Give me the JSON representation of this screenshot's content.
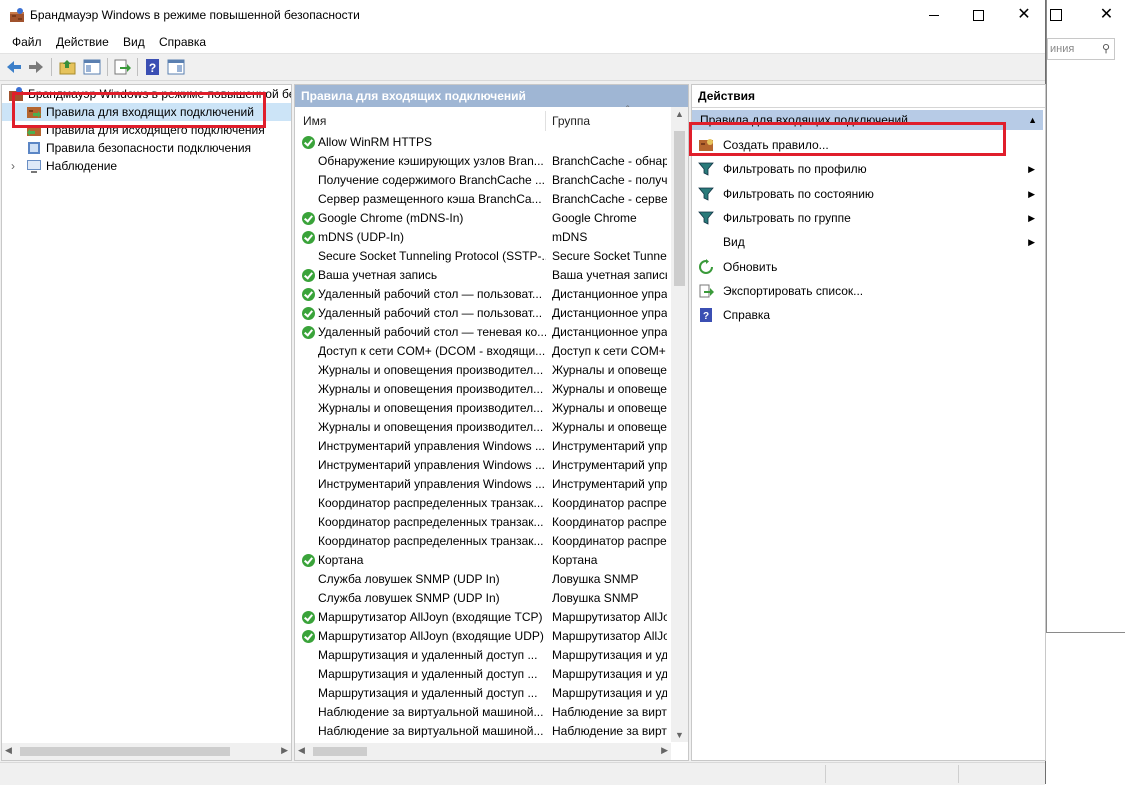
{
  "background_window": {
    "search_placeholder": "иния",
    "close_glyph": "✕"
  },
  "window": {
    "title": "Брандмауэр Windows в режиме повышенной безопасности",
    "min_glyph": "",
    "close_glyph": "✕"
  },
  "menu": [
    "Файл",
    "Действие",
    "Вид",
    "Справка"
  ],
  "tree": {
    "root": "Брандмауэр Windows в режиме повышенной безопасности на Локальный компьютер",
    "items": [
      "Правила для входящих подключений",
      "Правила для исходящего подключения",
      "Правила безопасности подключения",
      "Наблюдение"
    ]
  },
  "rules_pane": {
    "header": "Правила для входящих подключений",
    "col_name": "Имя",
    "col_group": "Группа",
    "rows": [
      {
        "enabled": true,
        "name": "Allow WinRM HTTPS",
        "group": ""
      },
      {
        "enabled": false,
        "name": "Обнаружение кэширующих узлов Bran...",
        "group": "BranchCache - обнар"
      },
      {
        "enabled": false,
        "name": "Получение содержимого BranchCache ...",
        "group": "BranchCache - получ"
      },
      {
        "enabled": false,
        "name": "Сервер размещенного кэша BranchCa...",
        "group": "BranchCache - сервер"
      },
      {
        "enabled": true,
        "name": "Google Chrome (mDNS-In)",
        "group": "Google Chrome"
      },
      {
        "enabled": true,
        "name": "mDNS (UDP-In)",
        "group": "mDNS"
      },
      {
        "enabled": false,
        "name": "Secure Socket Tunneling Protocol (SSTP-...",
        "group": "Secure Socket Tunneli"
      },
      {
        "enabled": true,
        "name": "Ваша учетная запись",
        "group": "Ваша учетная запись"
      },
      {
        "enabled": true,
        "name": "Удаленный рабочий стол — пользоват...",
        "group": "Дистанционное упра"
      },
      {
        "enabled": true,
        "name": "Удаленный рабочий стол — пользоват...",
        "group": "Дистанционное упра"
      },
      {
        "enabled": true,
        "name": "Удаленный рабочий стол — теневая ко...",
        "group": "Дистанционное упра"
      },
      {
        "enabled": false,
        "name": "Доступ к сети COM+ (DCOM - входящи...",
        "group": "Доступ к сети COM+"
      },
      {
        "enabled": false,
        "name": "Журналы и оповещения производител...",
        "group": "Журналы и оповеще"
      },
      {
        "enabled": false,
        "name": "Журналы и оповещения производител...",
        "group": "Журналы и оповеще"
      },
      {
        "enabled": false,
        "name": "Журналы и оповещения производител...",
        "group": "Журналы и оповеще"
      },
      {
        "enabled": false,
        "name": "Журналы и оповещения производител...",
        "group": "Журналы и оповеще"
      },
      {
        "enabled": false,
        "name": "Инструментарий управления Windows ...",
        "group": "Инструментарий упр"
      },
      {
        "enabled": false,
        "name": "Инструментарий управления Windows ...",
        "group": "Инструментарий упр"
      },
      {
        "enabled": false,
        "name": "Инструментарий управления Windows ...",
        "group": "Инструментарий упр"
      },
      {
        "enabled": false,
        "name": "Координатор распределенных транзак...",
        "group": "Координатор распре"
      },
      {
        "enabled": false,
        "name": "Координатор распределенных транзак...",
        "group": "Координатор распре"
      },
      {
        "enabled": false,
        "name": "Координатор распределенных транзак...",
        "group": "Координатор распре"
      },
      {
        "enabled": true,
        "name": "Кортана",
        "group": "Кортана"
      },
      {
        "enabled": false,
        "name": "Служба ловушек SNMP (UDP In)",
        "group": "Ловушка SNMP"
      },
      {
        "enabled": false,
        "name": "Служба ловушек SNMP (UDP In)",
        "group": "Ловушка SNMP"
      },
      {
        "enabled": true,
        "name": "Маршрутизатор AllJoyn (входящие TCP)",
        "group": "Маршрутизатор AllJo"
      },
      {
        "enabled": true,
        "name": "Маршрутизатор AllJoyn (входящие UDP)",
        "group": "Маршрутизатор AllJo"
      },
      {
        "enabled": false,
        "name": "Маршрутизация и удаленный доступ ...",
        "group": "Маршрутизация и уд"
      },
      {
        "enabled": false,
        "name": "Маршрутизация и удаленный доступ ...",
        "group": "Маршрутизация и уд"
      },
      {
        "enabled": false,
        "name": "Маршрутизация и удаленный доступ ...",
        "group": "Маршрутизация и уд"
      },
      {
        "enabled": false,
        "name": "Наблюдение за виртуальной машиной...",
        "group": "Наблюдение за вирту"
      },
      {
        "enabled": false,
        "name": "Наблюдение за виртуальной машиной...",
        "group": "Наблюдение за вирту"
      }
    ]
  },
  "actions_pane": {
    "header": "Действия",
    "subheader": "Правила для входящих подключений",
    "items": [
      {
        "label": "Создать правило...",
        "icon": "new-rule-icon",
        "submenu": false
      },
      {
        "label": "Фильтровать по профилю",
        "icon": "filter-icon",
        "submenu": true
      },
      {
        "label": "Фильтровать по состоянию",
        "icon": "filter-icon",
        "submenu": true
      },
      {
        "label": "Фильтровать по группе",
        "icon": "filter-icon",
        "submenu": true
      },
      {
        "label": "Вид",
        "icon": "",
        "submenu": true
      },
      {
        "label": "Обновить",
        "icon": "refresh-icon",
        "submenu": false
      },
      {
        "label": "Экспортировать список...",
        "icon": "export-icon",
        "submenu": false
      },
      {
        "label": "Справка",
        "icon": "help-icon",
        "submenu": false
      }
    ]
  },
  "colors": {
    "highlight": "#e01e2b",
    "pane_header": "#9fb6d4",
    "actions_subheader": "#b7cbe6",
    "enabled_check": "#3aa33a"
  }
}
